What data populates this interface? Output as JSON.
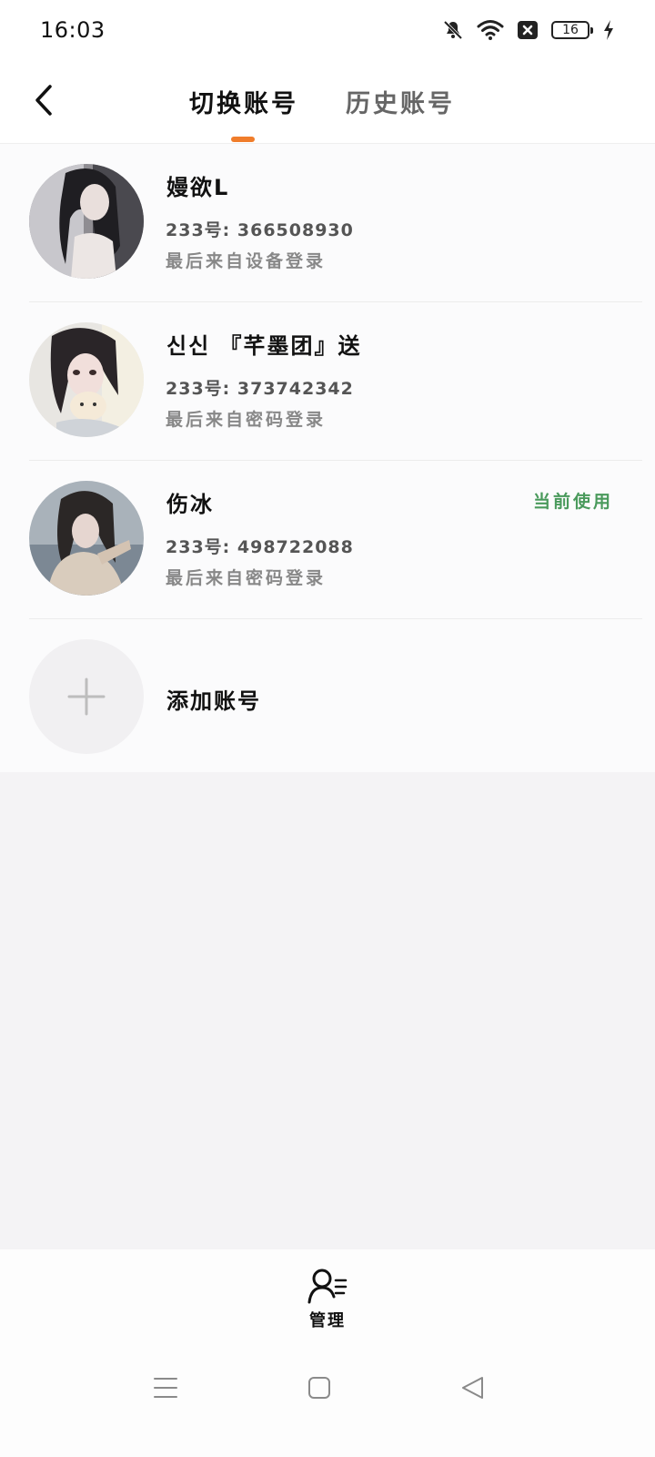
{
  "status_bar": {
    "time": "16:03",
    "battery": "16",
    "icons": [
      "bell-muted-icon",
      "wifi-icon",
      "close-box-icon",
      "battery-icon",
      "charging-icon"
    ]
  },
  "header": {
    "tabs": [
      {
        "label": "切换账号",
        "active": true
      },
      {
        "label": "历史账号",
        "active": false
      }
    ],
    "accent_color": "#f07d2b"
  },
  "accounts": [
    {
      "name": "嫚欲L",
      "id": "233号: 366508930",
      "login": "最后来自设备登录",
      "current": ""
    },
    {
      "name": "신신 『芊墨团』送",
      "id": "233号: 373742342",
      "login": "最后来自密码登录",
      "current": ""
    },
    {
      "name": "伤冰",
      "id": "233号: 498722088",
      "login": "最后来自密码登录",
      "current": "当前使用"
    }
  ],
  "add_account": {
    "label": "添加账号"
  },
  "bottom": {
    "manage_label": "管理"
  },
  "colors": {
    "current_badge": "#4a9a5c"
  }
}
